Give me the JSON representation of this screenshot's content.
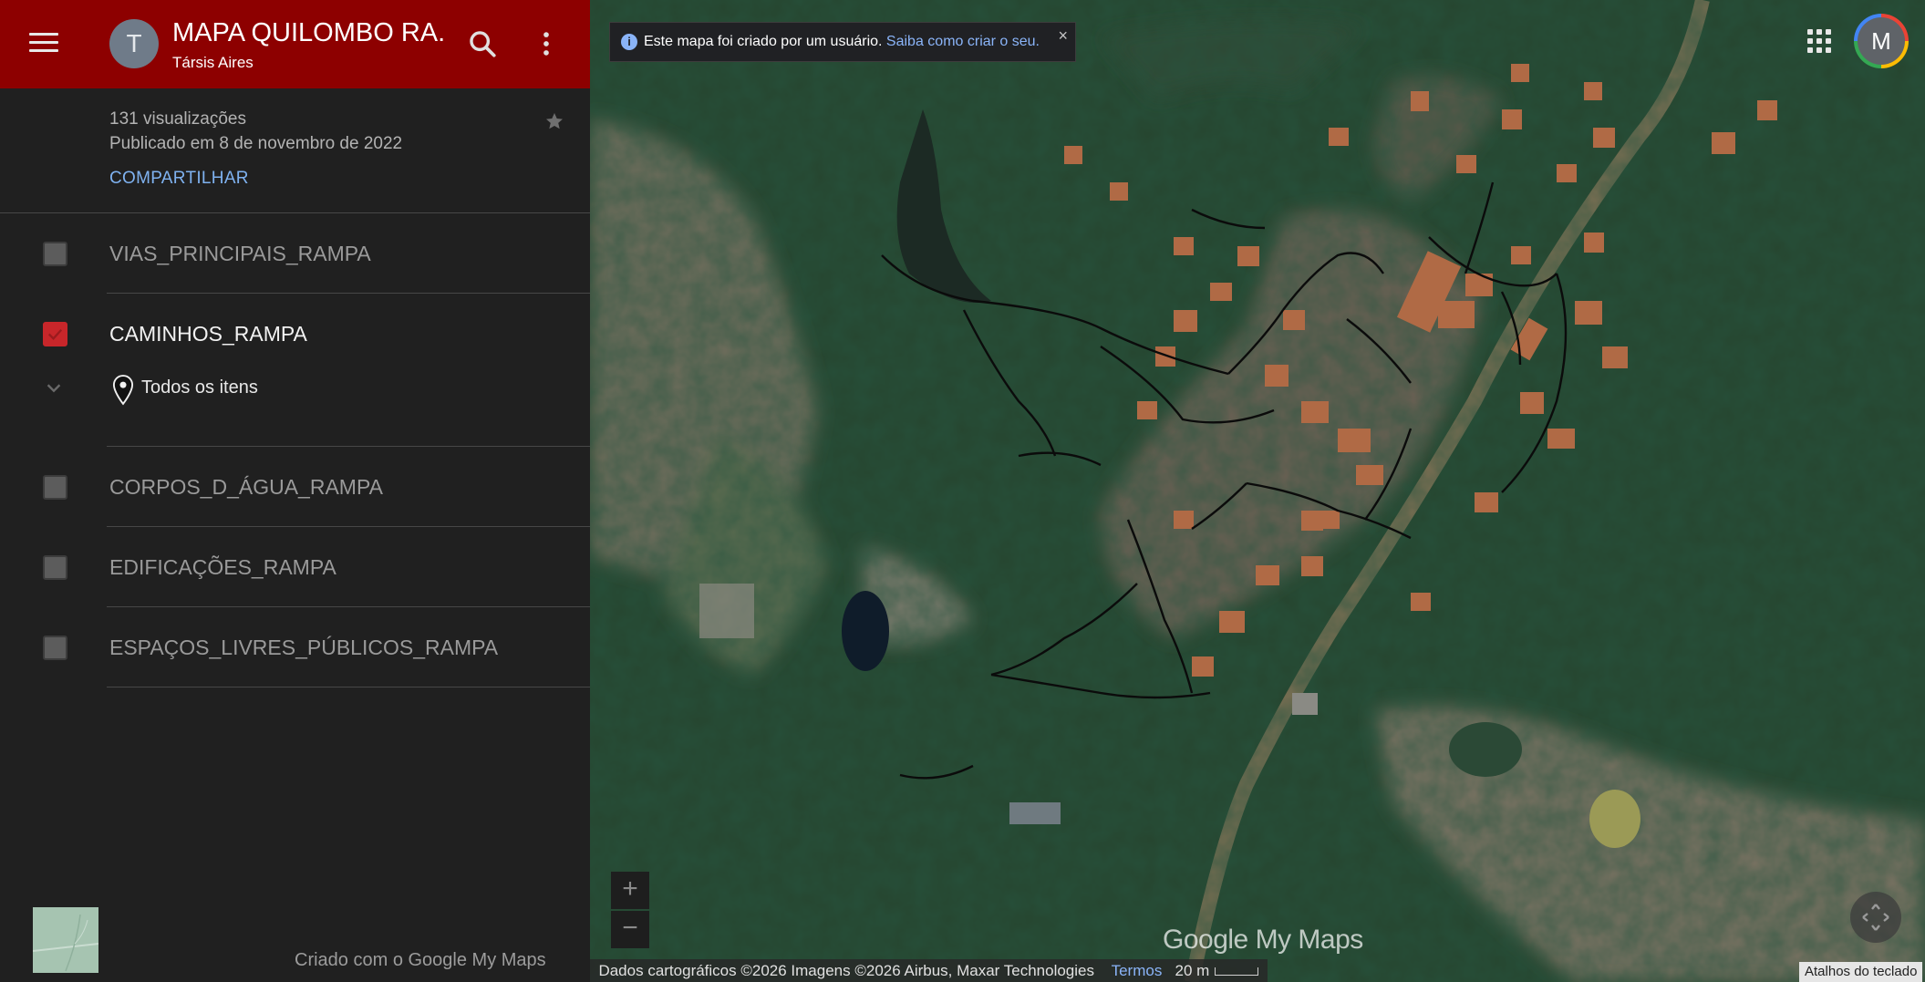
{
  "header": {
    "avatar_letter": "T",
    "title": "MAPA QUILOMBO RA...",
    "author": "Társis Aires"
  },
  "meta": {
    "views": "131 visualizações",
    "published": "Publicado em 8 de novembro de 2022",
    "share_label": "COMPARTILHAR"
  },
  "layers": [
    {
      "label": "VIAS_PRINCIPAIS_RAMPA",
      "checked": false
    },
    {
      "label": "CAMINHOS_RAMPA",
      "checked": true,
      "items_label": "Todos os itens"
    },
    {
      "label": "CORPOS_D_ÁGUA_RAMPA",
      "checked": false
    },
    {
      "label": "EDIFICAÇÕES_RAMPA",
      "checked": false
    },
    {
      "label": "ESPAÇOS_LIVRES_PÚBLICOS_RAMPA",
      "checked": false
    }
  ],
  "footer": {
    "credit": "Criado com o Google My Maps"
  },
  "map": {
    "notice_text": "Este mapa foi criado por um usuário.",
    "notice_link": "Saiba como criar o seu.",
    "notice_close": "×",
    "account_letter": "M",
    "zoom_in": "+",
    "zoom_out": "−",
    "watermark": "Google My Maps",
    "attribution": "Dados cartográficos ©2026 Imagens ©2026 Airbus, Maxar Technologies",
    "terms": "Termos",
    "scale_label": "20 m",
    "keyboard_shortcuts": "Atalhos do teclado"
  },
  "colors": {
    "header_bg": "#8d0000",
    "sidebar_bg": "#202020",
    "link": "#7fb2f0",
    "checkbox_checked": "#c8262a"
  },
  "icons": [
    "menu-icon",
    "search-icon",
    "more-vert-icon",
    "star-icon",
    "chevron-down-icon",
    "map-pin-icon",
    "info-icon",
    "close-icon",
    "apps-grid-icon",
    "compass-icon"
  ]
}
